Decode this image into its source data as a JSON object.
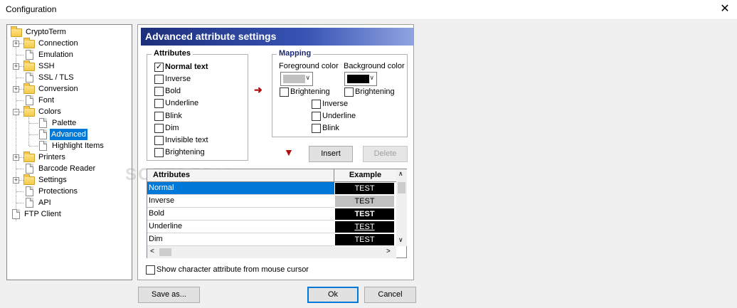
{
  "window": {
    "title": "Configuration",
    "close_glyph": "✕"
  },
  "tree": {
    "items": [
      {
        "label": "CryptoTerm"
      },
      {
        "label": "Connection"
      },
      {
        "label": "Emulation"
      },
      {
        "label": "SSH"
      },
      {
        "label": "SSL / TLS"
      },
      {
        "label": "Conversion"
      },
      {
        "label": "Font"
      },
      {
        "label": "Colors"
      },
      {
        "label": "Palette"
      },
      {
        "label": "Advanced"
      },
      {
        "label": "Highlight Items"
      },
      {
        "label": "Printers"
      },
      {
        "label": "Barcode Reader"
      },
      {
        "label": "Settings"
      },
      {
        "label": "Protections"
      },
      {
        "label": "API"
      },
      {
        "label": "FTP Client"
      }
    ]
  },
  "panel": {
    "header": "Advanced attribute settings",
    "attributes_group": {
      "title": "Attributes",
      "items": [
        {
          "label": "Normal text",
          "checked": true
        },
        {
          "label": "Inverse",
          "checked": false
        },
        {
          "label": "Bold",
          "checked": false
        },
        {
          "label": "Underline",
          "checked": false
        },
        {
          "label": "Blink",
          "checked": false
        },
        {
          "label": "Dim",
          "checked": false
        },
        {
          "label": "Invisible text",
          "checked": false
        },
        {
          "label": "Brightening",
          "checked": false
        }
      ]
    },
    "mapping_group": {
      "title": "Mapping",
      "fg_label": "Foreground color",
      "bg_label": "Background color",
      "fg_color": "#c0c0c0",
      "bg_color": "#000000",
      "fg_brightening": "Brightening",
      "bg_brightening": "Brightening",
      "inverse": "Inverse",
      "underline": "Underline",
      "blink": "Blink"
    },
    "insert_label": "Insert",
    "delete_label": "Delete",
    "table": {
      "headers": [
        "Attributes",
        "Example"
      ],
      "rows": [
        {
          "name": "Normal",
          "example": "TEST",
          "ex_bg": "#000000",
          "ex_fg": "#ffffff"
        },
        {
          "name": "Inverse",
          "example": "TEST",
          "ex_bg": "#c0c0c0",
          "ex_fg": "#000000"
        },
        {
          "name": "Bold",
          "example": "TEST",
          "ex_bg": "#000000",
          "ex_fg": "#ffffff"
        },
        {
          "name": "Underline",
          "example": "TEST",
          "ex_bg": "#000000",
          "ex_fg": "#ffffff"
        },
        {
          "name": "Dim",
          "example": "TEST",
          "ex_bg": "#000000",
          "ex_fg": "#ffffff"
        }
      ]
    },
    "show_attr_label": "Show character attribute from mouse cursor"
  },
  "footer": {
    "save_as": "Save as...",
    "ok": "Ok",
    "cancel": "Cancel"
  },
  "watermark": "SOFTPEDIA"
}
